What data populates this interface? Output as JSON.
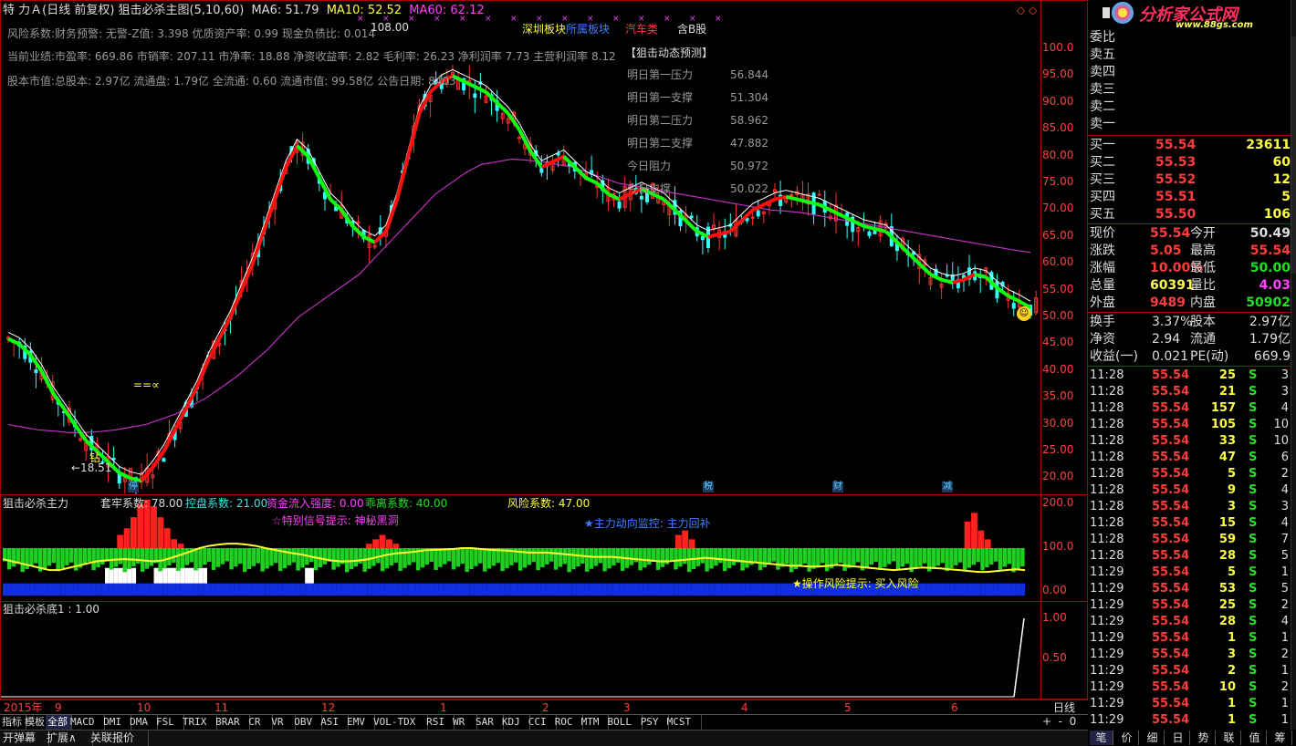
{
  "main": {
    "title": "特 力Ａ(日线 前复权) 狙击必杀主图(5,10,60)",
    "ma6": "MA6: 51.79",
    "ma10": "MA10: 52.52",
    "ma60": "MA60: 62.12",
    "info1": "风险系数:财务预警: 无警-Z值: 3.398 优质资产率: 0.99 现金负债比: 0.014",
    "info2": "当前业绩:市盈率: 669.86 市销率: 207.11 市净率: 18.88 净资收益率: 2.82 毛利率: 26.23 净利润率 7.73 主营利润率 8.12",
    "info3": "股本市值:总股本: 2.97亿 流通盘: 1.79亿 全流通: 0.60 流通市值: 99.58亿 公告日期: 8403",
    "board1": "深圳板块",
    "board2": "所属板块",
    "board3": "汽车类",
    "board4": "含B股",
    "pred_title": "【狙击动态预测】",
    "pred": [
      {
        "label": "明日第一压力",
        "value": "56.844"
      },
      {
        "label": "明日第一支撑",
        "value": "51.304"
      },
      {
        "label": "明日第二压力",
        "value": "58.962"
      },
      {
        "label": "明日第二支撑",
        "value": "47.882"
      },
      {
        "label": "今日阻力",
        "value": "50.972"
      },
      {
        "label": "今日支撑",
        "value": "50.022"
      }
    ],
    "high_label": "108.00",
    "low_label": "←18.51",
    "zuan": "钻",
    "eq_label": "==∝",
    "yaxis": [
      "100.0",
      "95.00",
      "90.00",
      "85.00",
      "80.00",
      "75.00",
      "70.00",
      "65.00",
      "60.00",
      "55.00",
      "50.00",
      "45.00",
      "40.00",
      "35.00",
      "30.00",
      "25.00",
      "20.00"
    ],
    "markers": [
      {
        "t": "停"
      },
      {
        "t": "税"
      },
      {
        "t": "财"
      },
      {
        "t": "减"
      }
    ],
    "chart_data": {
      "type": "candlestick",
      "title": "特 力Ａ(日线 前复权) 狙击必杀主图(5,10,60)",
      "series": [
        {
          "name": "MA6",
          "last": 51.79
        },
        {
          "name": "MA10",
          "last": 52.52
        },
        {
          "name": "MA60",
          "last": 62.12
        }
      ],
      "ylim": [
        17,
        109
      ],
      "close_path": [
        46,
        45,
        43,
        40,
        36,
        33,
        30,
        27,
        25,
        23,
        21,
        20,
        19.5,
        22,
        25,
        29,
        33,
        37,
        42,
        46,
        50,
        55,
        60,
        66,
        72,
        78,
        82,
        80,
        76,
        72,
        70,
        67,
        65,
        64,
        66,
        72,
        80,
        88,
        92,
        94,
        95,
        94,
        93,
        92,
        90,
        88,
        85,
        81,
        78,
        79,
        80,
        78,
        76,
        75,
        73,
        72,
        73,
        74,
        73,
        72,
        70,
        68,
        66,
        65,
        65.5,
        66,
        68,
        70,
        71,
        72,
        72.5,
        72,
        71.5,
        71,
        70,
        69,
        68,
        67,
        66.5,
        66,
        64,
        62,
        60,
        58,
        57,
        56.5,
        57,
        58,
        57.5,
        55.5,
        54,
        53,
        51.79
      ],
      "ma60_path": [
        30,
        29.5,
        29,
        28.8,
        28.5,
        28.5,
        28.7,
        29,
        29.5,
        30,
        31,
        32,
        33.5,
        35,
        37,
        39,
        41.5,
        44,
        47,
        50,
        52,
        54,
        56,
        58,
        61,
        64,
        67,
        70,
        73,
        75,
        77,
        78.5,
        79,
        79.5,
        79.3,
        79,
        78.5,
        78,
        77,
        76,
        75,
        74.5,
        74,
        73.5,
        73,
        72.5,
        72,
        71.5,
        71,
        70.5,
        70,
        69.8,
        69.5,
        69,
        68.5,
        68,
        67.5,
        67,
        66.5,
        66,
        65.5,
        65,
        64.5,
        64,
        63.5,
        63,
        62.5,
        62.12
      ]
    }
  },
  "ind1": {
    "name": "狙击必杀主力",
    "items": [
      {
        "label": "套牢系数: 78.00"
      },
      {
        "label": "控盘系数: 21.00"
      },
      {
        "label": "资金流入强度: 0.00"
      },
      {
        "label": "乖离系数: 40.00"
      },
      {
        "label": "风险系数: 47.00"
      }
    ],
    "signal": "☆特别信号提示: 神秘黑洞",
    "monitor": "★主力动向监控: 主力回补",
    "risk": "★操作风险提示: 买入风险",
    "yaxis": [
      "200.0",
      "100.0",
      "0.00"
    ],
    "chart_data": {
      "type": "bar",
      "ylim": [
        -20,
        220
      ],
      "red": [
        0,
        0,
        0,
        0,
        0,
        0,
        0,
        0,
        0,
        0,
        0,
        0,
        0,
        0,
        0,
        0,
        0,
        30,
        45,
        70,
        100,
        110,
        95,
        70,
        45,
        20,
        10,
        0,
        0,
        0,
        0,
        0,
        0,
        0,
        0,
        0,
        0,
        0,
        0,
        0,
        0,
        0,
        0,
        0,
        0,
        0,
        0,
        0,
        0,
        0,
        0,
        0,
        0,
        0,
        10,
        20,
        30,
        20,
        10,
        0,
        0,
        0,
        0,
        0,
        0,
        0,
        0,
        0,
        0,
        0,
        0,
        0,
        0,
        0,
        0,
        0,
        0,
        0,
        0,
        0,
        0,
        0,
        0,
        0,
        0,
        0,
        0,
        0,
        0,
        0,
        0,
        0,
        0,
        0,
        0,
        0,
        0,
        0,
        0,
        0,
        30,
        40,
        20,
        0,
        0,
        0,
        0,
        0,
        0,
        0,
        0,
        0,
        0,
        0,
        0,
        0,
        0,
        0,
        0,
        0,
        0,
        0,
        0,
        0,
        0,
        0,
        0,
        0,
        0,
        0,
        0,
        0,
        0,
        0,
        0,
        0,
        0,
        0,
        0,
        0,
        0,
        0,
        0,
        60,
        80,
        40,
        20,
        0,
        0,
        0,
        0,
        0
      ],
      "yellow_line": [
        75,
        70,
        65,
        60,
        55,
        50,
        50,
        55,
        60,
        65,
        70,
        72,
        74,
        75,
        74,
        72,
        70,
        72,
        78,
        85,
        92,
        100,
        105,
        108,
        110,
        110,
        108,
        105,
        100,
        96,
        92,
        88,
        85,
        80,
        76,
        72,
        70,
        70,
        72,
        75,
        80,
        85,
        88,
        90,
        92,
        95,
        96,
        97,
        98,
        100,
        100,
        98,
        96,
        95,
        94,
        92,
        90,
        90,
        90,
        88,
        86,
        84,
        82,
        80,
        80,
        80,
        78,
        76,
        74,
        72,
        70,
        70,
        72,
        74,
        76,
        78,
        76,
        74,
        72,
        70,
        68,
        66,
        64,
        62,
        60,
        60,
        58,
        58,
        60,
        62,
        60,
        58,
        56,
        54,
        52,
        50,
        52,
        54,
        56,
        55,
        54,
        52,
        50,
        48,
        46,
        46,
        48,
        50,
        52,
        50
      ]
    }
  },
  "ind2": {
    "name": "狙击必杀底1 : 1.00",
    "yaxis": [
      "1.00",
      "0.50"
    ],
    "chart_data": {
      "type": "line",
      "ylim": [
        0,
        1.1
      ],
      "x_spike_at_end": true,
      "last": 1.0
    }
  },
  "xaxis": {
    "labels": [
      "2015年",
      "9",
      "10",
      "11",
      "12",
      "1",
      "2",
      "3",
      "4",
      "5",
      "6"
    ],
    "period": "日线"
  },
  "tabs": [
    "指标",
    "模板",
    "全部",
    "MACD",
    "DMI",
    "DMA",
    "FSL",
    "TRIX",
    "BRAR",
    "CR",
    "VR",
    "OBV",
    "ASI",
    "EMV",
    "VOL-TDX",
    "RSI",
    "WR",
    "SAR",
    "KDJ",
    "CCI",
    "ROC",
    "MTM",
    "BOLL",
    "PSY",
    "MCST"
  ],
  "foot": [
    "开弹幕",
    "扩展∧",
    "关联报价"
  ],
  "right": {
    "logo": "分析家公式网",
    "logo_url": "www.88gs.com",
    "wei": "委比",
    "asks": [
      {
        "l": "卖五"
      },
      {
        "l": "卖四"
      },
      {
        "l": "卖三"
      },
      {
        "l": "卖二"
      },
      {
        "l": "卖一"
      }
    ],
    "bids": [
      {
        "l": "买一",
        "p": "55.54",
        "v": "23611"
      },
      {
        "l": "买二",
        "p": "55.53",
        "v": "60"
      },
      {
        "l": "买三",
        "p": "55.52",
        "v": "12"
      },
      {
        "l": "买四",
        "p": "55.51",
        "v": "5"
      },
      {
        "l": "买五",
        "p": "55.50",
        "v": "106"
      }
    ],
    "stats": [
      {
        "a": "现价",
        "av": "55.54",
        "b": "今开",
        "bv": "50.49",
        "ac": "r",
        "bc": "w"
      },
      {
        "a": "涨跌",
        "av": "5.05",
        "b": "最高",
        "bv": "55.54",
        "ac": "r",
        "bc": "r"
      },
      {
        "a": "涨幅",
        "av": "10.00%",
        "b": "最低",
        "bv": "50.00",
        "ac": "r",
        "bc": "g"
      },
      {
        "a": "总量",
        "av": "60391",
        "b": "量比",
        "bv": "4.03",
        "ac": "y",
        "bc": "m"
      },
      {
        "a": "外盘",
        "av": "9489",
        "b": "内盘",
        "bv": "50902",
        "ac": "r",
        "bc": "g"
      }
    ],
    "stats2": [
      {
        "a": "换手",
        "av": "3.37%",
        "b": "股本",
        "bv": "2.97亿"
      },
      {
        "a": "净资",
        "av": "2.94",
        "b": "流通",
        "bv": "1.79亿"
      },
      {
        "a": "收益(一)",
        "av": "0.021",
        "b": "PE(动)",
        "bv": "669.9"
      }
    ],
    "ticks": [
      {
        "t": "11:28",
        "p": "55.54",
        "v": "25",
        "s": "S",
        "n": "3"
      },
      {
        "t": "11:28",
        "p": "55.54",
        "v": "21",
        "s": "S",
        "n": "3"
      },
      {
        "t": "11:28",
        "p": "55.54",
        "v": "157",
        "s": "S",
        "n": "4"
      },
      {
        "t": "11:28",
        "p": "55.54",
        "v": "105",
        "s": "S",
        "n": "10"
      },
      {
        "t": "11:28",
        "p": "55.54",
        "v": "33",
        "s": "S",
        "n": "10"
      },
      {
        "t": "11:28",
        "p": "55.54",
        "v": "47",
        "s": "S",
        "n": "6"
      },
      {
        "t": "11:28",
        "p": "55.54",
        "v": "5",
        "s": "S",
        "n": "2"
      },
      {
        "t": "11:28",
        "p": "55.54",
        "v": "9",
        "s": "S",
        "n": "4"
      },
      {
        "t": "11:28",
        "p": "55.54",
        "v": "3",
        "s": "S",
        "n": "3"
      },
      {
        "t": "11:28",
        "p": "55.54",
        "v": "15",
        "s": "S",
        "n": "4"
      },
      {
        "t": "11:28",
        "p": "55.54",
        "v": "59",
        "s": "S",
        "n": "7"
      },
      {
        "t": "11:28",
        "p": "55.54",
        "v": "28",
        "s": "S",
        "n": "5"
      },
      {
        "t": "11:29",
        "p": "55.54",
        "v": "5",
        "s": "S",
        "n": "1"
      },
      {
        "t": "11:29",
        "p": "55.54",
        "v": "53",
        "s": "S",
        "n": "5"
      },
      {
        "t": "11:29",
        "p": "55.54",
        "v": "25",
        "s": "S",
        "n": "2"
      },
      {
        "t": "11:29",
        "p": "55.54",
        "v": "28",
        "s": "S",
        "n": "4"
      },
      {
        "t": "11:29",
        "p": "55.54",
        "v": "1",
        "s": "S",
        "n": "1"
      },
      {
        "t": "11:29",
        "p": "55.54",
        "v": "3",
        "s": "S",
        "n": "2"
      },
      {
        "t": "11:29",
        "p": "55.54",
        "v": "2",
        "s": "S",
        "n": "1"
      },
      {
        "t": "11:29",
        "p": "55.54",
        "v": "10",
        "s": "S",
        "n": "2"
      },
      {
        "t": "11:29",
        "p": "55.54",
        "v": "1",
        "s": "S",
        "n": "1"
      },
      {
        "t": "11:29",
        "p": "55.54",
        "v": "1",
        "s": "S",
        "n": "1"
      }
    ],
    "btabs": [
      "笔",
      "价",
      "细",
      "日",
      "势",
      "联",
      "值",
      "筹"
    ]
  }
}
